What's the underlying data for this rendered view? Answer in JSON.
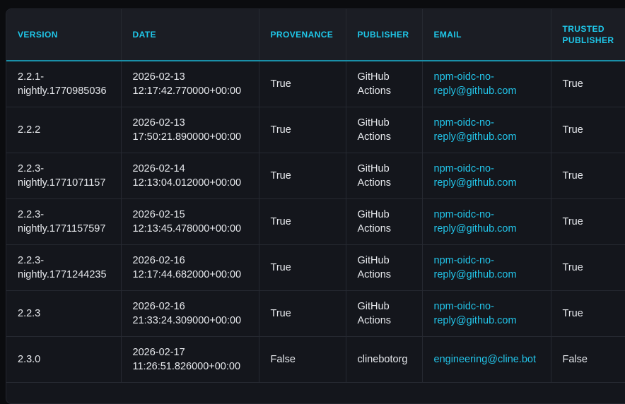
{
  "table": {
    "headers": {
      "version": "VERSION",
      "date": "DATE",
      "provenance": "PROVENANCE",
      "publisher": "PUBLISHER",
      "email": "EMAIL",
      "trusted_publisher_1": "TRUSTED",
      "trusted_publisher_2": "PUBLISHER"
    },
    "rows": [
      {
        "version_1": "2.2.1-",
        "version_2": "nightly.1770985036",
        "date_1": "2026-02-13",
        "date_2": "12:17:42.770000+00:00",
        "provenance": "True",
        "publisher_1": "GitHub",
        "publisher_2": "Actions",
        "email_1": "npm-oidc-no-",
        "email_2": "reply@github.com",
        "trusted": "True"
      },
      {
        "version_1": "2.2.2",
        "version_2": "",
        "date_1": "2026-02-13",
        "date_2": "17:50:21.890000+00:00",
        "provenance": "True",
        "publisher_1": "GitHub",
        "publisher_2": "Actions",
        "email_1": "npm-oidc-no-",
        "email_2": "reply@github.com",
        "trusted": "True"
      },
      {
        "version_1": "2.2.3-",
        "version_2": "nightly.1771071157",
        "date_1": "2026-02-14",
        "date_2": "12:13:04.012000+00:00",
        "provenance": "True",
        "publisher_1": "GitHub",
        "publisher_2": "Actions",
        "email_1": "npm-oidc-no-",
        "email_2": "reply@github.com",
        "trusted": "True"
      },
      {
        "version_1": "2.2.3-",
        "version_2": "nightly.1771157597",
        "date_1": "2026-02-15",
        "date_2": "12:13:45.478000+00:00",
        "provenance": "True",
        "publisher_1": "GitHub",
        "publisher_2": "Actions",
        "email_1": "npm-oidc-no-",
        "email_2": "reply@github.com",
        "trusted": "True"
      },
      {
        "version_1": "2.2.3-",
        "version_2": "nightly.1771244235",
        "date_1": "2026-02-16",
        "date_2": "12:17:44.682000+00:00",
        "provenance": "True",
        "publisher_1": "GitHub",
        "publisher_2": "Actions",
        "email_1": "npm-oidc-no-",
        "email_2": "reply@github.com",
        "trusted": "True"
      },
      {
        "version_1": "2.2.3",
        "version_2": "",
        "date_1": "2026-02-16",
        "date_2": "21:33:24.309000+00:00",
        "provenance": "True",
        "publisher_1": "GitHub",
        "publisher_2": "Actions",
        "email_1": "npm-oidc-no-",
        "email_2": "reply@github.com",
        "trusted": "True"
      },
      {
        "version_1": "2.3.0",
        "version_2": "",
        "date_1": "2026-02-17",
        "date_2": "11:26:51.826000+00:00",
        "provenance": "False",
        "publisher_1": "clinebotorg",
        "publisher_2": "",
        "email_1": "engineering@cline.bot",
        "email_2": "",
        "trusted": "False"
      }
    ]
  },
  "colors": {
    "header_text": "#1fc8ea",
    "email_link": "#22c5ea",
    "background": "#14161c",
    "header_background": "#1b1d24"
  }
}
